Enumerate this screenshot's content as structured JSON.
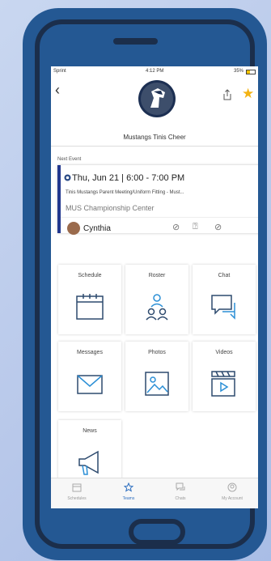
{
  "status": {
    "carrier": "Sprint",
    "time": "4:12 PM",
    "battery": "35%"
  },
  "header": {
    "back_icon": "chevron-left-icon",
    "team_name": "Mustangs Tinis Cheer"
  },
  "next_event": {
    "section_label": "Next Event",
    "date": "Thu, Jun 21 | 6:00 - 7:00 PM",
    "title": "Tinis Mustangs Parent Meeting/Uniform Fitting - Must...",
    "location": "MUS Championship Center",
    "person": "Cynthia"
  },
  "tiles": [
    {
      "label": "Schedule",
      "icon": "calendar-icon"
    },
    {
      "label": "Roster",
      "icon": "people-icon"
    },
    {
      "label": "Chat",
      "icon": "chat-bubbles-icon"
    },
    {
      "label": "Messages",
      "icon": "envelope-icon"
    },
    {
      "label": "Photos",
      "icon": "image-icon"
    },
    {
      "label": "Videos",
      "icon": "video-icon"
    },
    {
      "label": "News",
      "icon": "megaphone-icon"
    }
  ],
  "tabs": [
    {
      "label": "Schedules",
      "active": false
    },
    {
      "label": "Teams",
      "active": true
    },
    {
      "label": "Chats",
      "active": false
    },
    {
      "label": "My Account",
      "active": false
    }
  ],
  "colors": {
    "phone": "#245893",
    "accent": "#23388f",
    "star": "#f3b313",
    "active_tab": "#2e6fc0"
  }
}
